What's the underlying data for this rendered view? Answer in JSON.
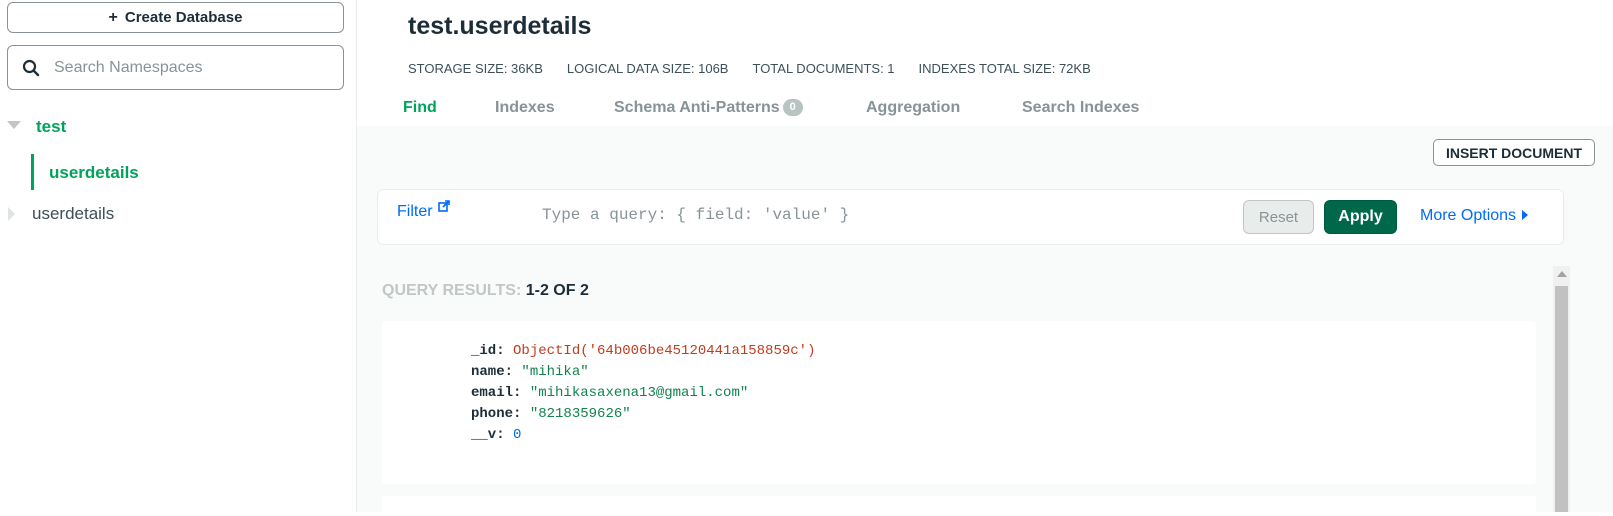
{
  "sidebar": {
    "create_button_label": "Create Database",
    "search_placeholder": "Search Namespaces",
    "databases": [
      {
        "name": "test",
        "expanded": true,
        "collections": [
          "userdetails"
        ]
      },
      {
        "name": "userdetails",
        "expanded": false
      }
    ]
  },
  "header": {
    "namespace": "test.userdetails",
    "stats": {
      "storage_size": "STORAGE SIZE: 36KB",
      "logical_size": "LOGICAL DATA SIZE: 106B",
      "total_docs": "TOTAL DOCUMENTS: 1",
      "indexes_size": "INDEXES TOTAL SIZE: 72KB"
    },
    "tabs": [
      {
        "label": "Find",
        "active": true
      },
      {
        "label": "Indexes"
      },
      {
        "label": "Schema Anti-Patterns",
        "badge": "0"
      },
      {
        "label": "Aggregation"
      },
      {
        "label": "Search Indexes"
      }
    ]
  },
  "toolbar": {
    "insert_label": "INSERT DOCUMENT",
    "filter_label": "Filter",
    "query_placeholder": "Type a query: { field: 'value' }",
    "reset_label": "Reset",
    "apply_label": "Apply",
    "more_options_label": "More Options"
  },
  "results": {
    "label": "QUERY RESULTS:",
    "range": "1-2 OF 2",
    "document": {
      "id_key": "_id:",
      "id_value": "ObjectId('64b006be45120441a158859c')",
      "name_key": "name:",
      "name_value": "\"mihika\"",
      "email_key": "email:",
      "email_value": "\"mihikasaxena13@gmail.com\"",
      "phone_key": "phone:",
      "phone_value": "\"8218359626\"",
      "v_key": "__v:",
      "v_value": "0"
    }
  },
  "colors": {
    "accent_green": "#00a35c",
    "apply_green": "#00684a",
    "link_blue": "#016bf8",
    "oid_red": "#c13d1f"
  }
}
